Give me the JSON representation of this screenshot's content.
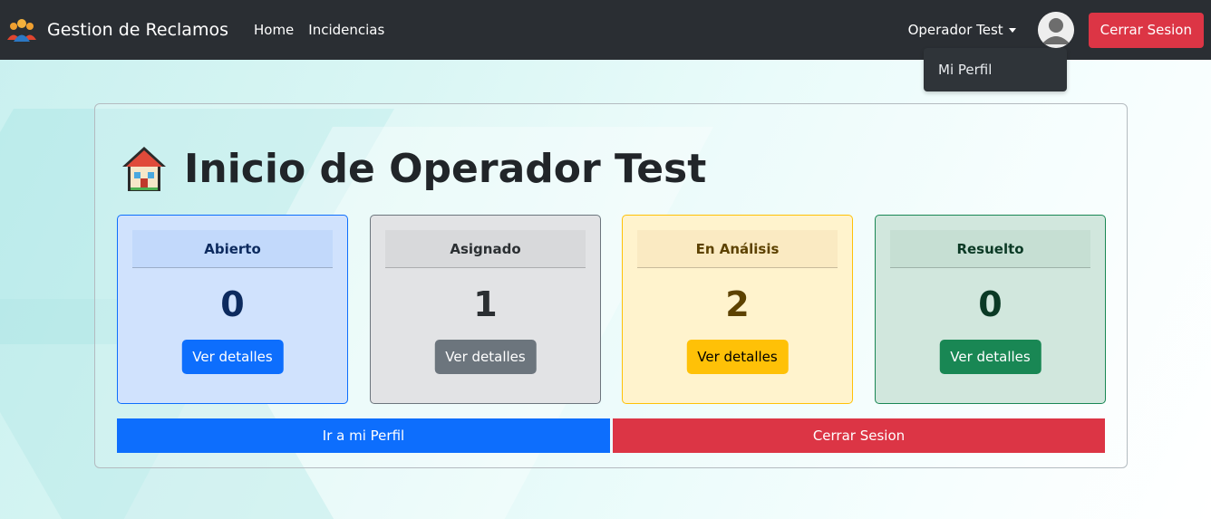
{
  "navbar": {
    "brand": "Gestion de Reclamos",
    "links": [
      "Home",
      "Incidencias"
    ],
    "user_menu": "Operador Test",
    "logout": "Cerrar Sesion"
  },
  "dropdown": {
    "items": [
      "Mi Perfil"
    ]
  },
  "main": {
    "title": "Inicio de Operador Test",
    "cards": [
      {
        "label": "Abierto",
        "count": "0",
        "button": "Ver detalles",
        "color": "#0d6efd"
      },
      {
        "label": "Asignado",
        "count": "1",
        "button": "Ver detalles",
        "color": "#6c757d"
      },
      {
        "label": "En Análisis",
        "count": "2",
        "button": "Ver detalles",
        "color": "#ffc107"
      },
      {
        "label": "Resuelto",
        "count": "0",
        "button": "Ver detalles",
        "color": "#198754"
      }
    ],
    "profile_button": "Ir a mi Perfil",
    "logout_button": "Cerrar Sesion"
  },
  "icons": {
    "brand": "users-group-icon",
    "user": "user-avatar-icon",
    "title": "house-icon",
    "dropdown": "caret-down-icon"
  }
}
